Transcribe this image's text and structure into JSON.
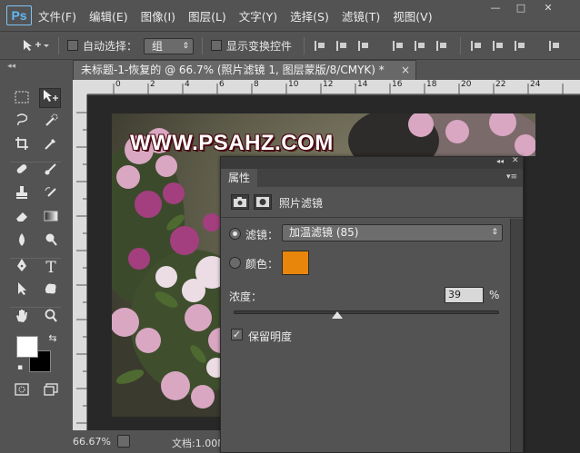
{
  "app": {
    "logo": "Ps"
  },
  "menu": [
    "文件(F)",
    "编辑(E)",
    "图像(I)",
    "图层(L)",
    "文字(Y)",
    "选择(S)",
    "滤镜(T)",
    "视图(V)"
  ],
  "window_buttons": {
    "minimize": "—",
    "restore": "□",
    "close": "✕"
  },
  "options": {
    "auto_select_label": "自动选择：",
    "auto_select_value": "组",
    "show_transform_label": "显示变换控件"
  },
  "document": {
    "tab_title": "未标题-1-恢复的 @ 66.7% (照片滤镜 1, 图层蒙版/8/CMYK) *",
    "close": "×",
    "watermark": "WWW.PSAHZ.COM",
    "zoom": "66.67%",
    "doc_info": "文档:1.00M"
  },
  "rulers": {
    "h": [
      "0",
      "2",
      "4",
      "6",
      "8",
      "10",
      "12",
      "14",
      "16",
      "18",
      "20",
      "22",
      "24"
    ]
  },
  "panel": {
    "collapse": "◂◂",
    "close": "✕",
    "menu": "▾≡",
    "tab": "属性",
    "title": "照片滤镜",
    "filter_label": "滤镜：",
    "filter_value": "加温滤镜 (85)",
    "color_label": "颜色：",
    "color_value": "#e8860c",
    "density_label": "浓度：",
    "density_value": "39",
    "density_unit": "%",
    "density_fraction": 0.39,
    "preserve_label": "保留明度",
    "preserve_checked": true
  },
  "toolbar_icons": [
    "move-tool",
    "marquee-tool",
    "lasso-tool",
    "quick-select-tool",
    "crop-tool",
    "eyedropper-tool",
    "healing-tool",
    "brush-tool",
    "clone-stamp-tool",
    "history-brush-tool",
    "eraser-tool",
    "gradient-tool",
    "blur-tool",
    "dodge-tool",
    "pen-tool",
    "type-tool",
    "path-select-tool",
    "shape-tool",
    "hand-tool",
    "zoom-tool"
  ]
}
